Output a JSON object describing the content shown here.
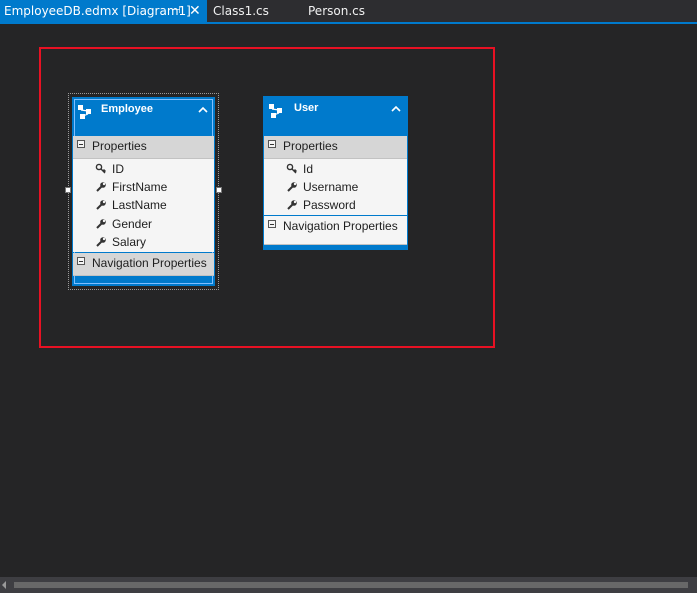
{
  "tabs": [
    {
      "label": "EmployeeDB.edmx [Diagram1]",
      "active": true
    },
    {
      "label": "Class1.cs",
      "active": false
    },
    {
      "label": "Person.cs",
      "active": false
    }
  ],
  "icons": {
    "pin": "pin-icon",
    "close": "close-icon",
    "entity": "entity-icon",
    "key": "key-icon",
    "wrench": "wrench-icon",
    "collapse": "chevron-up-icon"
  },
  "colors": {
    "accent": "#007acc",
    "highlight": "#e81123",
    "canvas": "#252526"
  },
  "entities": [
    {
      "name": "Employee",
      "selected": true,
      "properties_label": "Properties",
      "properties": [
        {
          "name": "ID",
          "icon": "key-icon"
        },
        {
          "name": "FirstName",
          "icon": "wrench-icon"
        },
        {
          "name": "LastName",
          "icon": "wrench-icon"
        },
        {
          "name": "Gender",
          "icon": "wrench-icon"
        },
        {
          "name": "Salary",
          "icon": "wrench-icon"
        }
      ],
      "navigation_label": "Navigation Properties"
    },
    {
      "name": "User",
      "selected": false,
      "properties_label": "Properties",
      "properties": [
        {
          "name": "Id",
          "icon": "key-icon"
        },
        {
          "name": "Username",
          "icon": "wrench-icon"
        },
        {
          "name": "Password",
          "icon": "wrench-icon"
        }
      ],
      "navigation_label": "Navigation Properties"
    }
  ]
}
